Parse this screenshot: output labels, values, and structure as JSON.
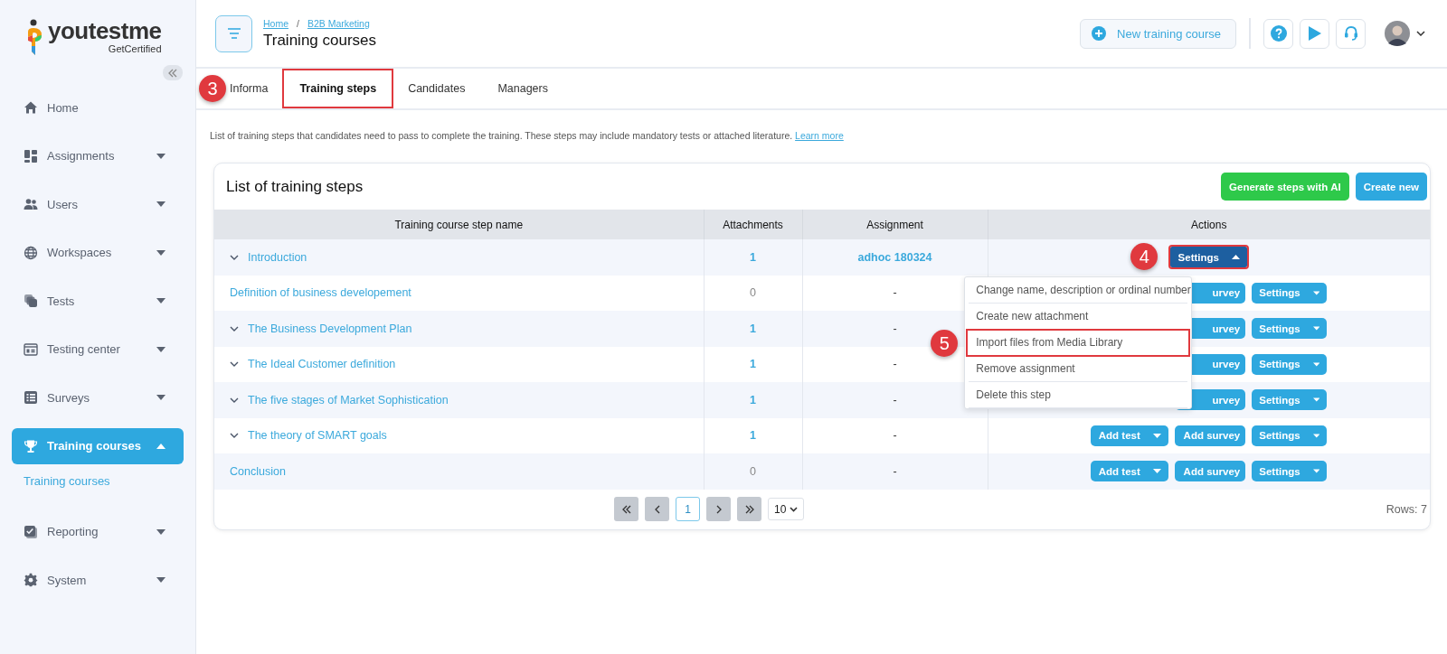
{
  "logo": {
    "name": "youtestme",
    "tagline": "GetCertified"
  },
  "sidebar": {
    "items": [
      {
        "label": "Home",
        "has_children": false,
        "selected": false
      },
      {
        "label": "Assignments",
        "has_children": true,
        "expanded": false,
        "selected": false
      },
      {
        "label": "Users",
        "has_children": true,
        "expanded": false,
        "selected": false
      },
      {
        "label": "Workspaces",
        "has_children": true,
        "expanded": false,
        "selected": false
      },
      {
        "label": "Tests",
        "has_children": true,
        "expanded": false,
        "selected": false
      },
      {
        "label": "Testing center",
        "has_children": true,
        "expanded": false,
        "selected": false
      },
      {
        "label": "Surveys",
        "has_children": true,
        "expanded": false,
        "selected": false
      },
      {
        "label": "Training courses",
        "has_children": true,
        "expanded": true,
        "selected": true,
        "children": [
          {
            "label": "Training courses",
            "selected": true
          }
        ]
      },
      {
        "label": "Reporting",
        "has_children": true,
        "expanded": false,
        "selected": false
      },
      {
        "label": "System",
        "has_children": true,
        "expanded": false,
        "selected": false
      }
    ]
  },
  "breadcrumb": [
    "Home",
    "B2B Marketing"
  ],
  "breadcrumb_separator": "/",
  "page_title": "Training courses",
  "new_button": "New training course",
  "tabs": [
    {
      "label": "Informa",
      "selected": false,
      "highlighted": false
    },
    {
      "label": "Training steps",
      "selected": true,
      "highlighted": true
    },
    {
      "label": "Candidates",
      "selected": false,
      "highlighted": false
    },
    {
      "label": "Managers",
      "selected": false,
      "highlighted": false
    }
  ],
  "description": {
    "text": "List of training steps that candidates need to pass to complete the training. These steps may include mandatory tests or attached literature.",
    "link": "Learn more"
  },
  "card": {
    "title": "List of training steps",
    "buttons": [
      {
        "label": "Generate steps with AI",
        "kind": "ai"
      },
      {
        "label": "Create new",
        "kind": "primary"
      }
    ]
  },
  "table": {
    "columns": [
      "Training course step name",
      "Attachments",
      "Assignment",
      "Actions"
    ],
    "rows": [
      {
        "name": "Introduction",
        "expandable": true,
        "attachments": "1",
        "attachments_linked": true,
        "assignment": "adhoc 180324",
        "assignment_linked": true,
        "actions": [
          {
            "kind": "settings",
            "label": "Settings",
            "open": true,
            "highlighted": true
          }
        ]
      },
      {
        "name": "Definition of business developement",
        "expandable": false,
        "attachments": "0",
        "attachments_linked": false,
        "assignment": "-",
        "assignment_linked": false,
        "actions": [
          {
            "kind": "survey",
            "label": "urvey",
            "open": false,
            "highlighted": false
          },
          {
            "kind": "settings",
            "label": "Settings",
            "open": false,
            "highlighted": false
          }
        ]
      },
      {
        "name": "The Business Development Plan",
        "expandable": true,
        "attachments": "1",
        "attachments_linked": true,
        "assignment": "-",
        "assignment_linked": false,
        "actions": [
          {
            "kind": "survey",
            "label": "urvey",
            "open": false,
            "highlighted": false
          },
          {
            "kind": "settings",
            "label": "Settings",
            "open": false,
            "highlighted": false
          }
        ]
      },
      {
        "name": "The Ideal Customer definition",
        "expandable": true,
        "attachments": "1",
        "attachments_linked": true,
        "assignment": "-",
        "assignment_linked": false,
        "actions": [
          {
            "kind": "survey",
            "label": "urvey",
            "open": false,
            "highlighted": false
          },
          {
            "kind": "settings",
            "label": "Settings",
            "open": false,
            "highlighted": false
          }
        ]
      },
      {
        "name": "The five stages of Market Sophistication",
        "expandable": true,
        "attachments": "1",
        "attachments_linked": true,
        "assignment": "-",
        "assignment_linked": false,
        "actions": [
          {
            "kind": "survey",
            "label": "urvey",
            "open": false,
            "highlighted": false
          },
          {
            "kind": "settings",
            "label": "Settings",
            "open": false,
            "highlighted": false
          }
        ]
      },
      {
        "name": "The theory of SMART goals",
        "expandable": true,
        "attachments": "1",
        "attachments_linked": true,
        "assignment": "-",
        "assignment_linked": false,
        "actions": [
          {
            "kind": "test",
            "label": "Add test",
            "open": false,
            "highlighted": false
          },
          {
            "kind": "survey",
            "label": "Add survey",
            "open": false,
            "highlighted": false
          },
          {
            "kind": "settings",
            "label": "Settings",
            "open": false,
            "highlighted": false
          }
        ]
      },
      {
        "name": "Conclusion",
        "expandable": false,
        "attachments": "0",
        "attachments_linked": false,
        "assignment": "-",
        "assignment_linked": false,
        "actions": [
          {
            "kind": "test",
            "label": "Add test",
            "open": false,
            "highlighted": false
          },
          {
            "kind": "survey",
            "label": "Add survey",
            "open": false,
            "highlighted": false
          },
          {
            "kind": "settings",
            "label": "Settings",
            "open": false,
            "highlighted": false
          }
        ]
      }
    ]
  },
  "settings_menu": [
    {
      "label": "Change name, description or ordinal number",
      "highlighted": false
    },
    {
      "label": "Create new attachment",
      "highlighted": false
    },
    {
      "label": "Import files from Media Library",
      "highlighted": true
    },
    {
      "label": "Remove assignment",
      "highlighted": false
    },
    {
      "label": "Delete this step",
      "highlighted": false
    }
  ],
  "pagination": {
    "pages": [
      {
        "label": "1",
        "selected": true
      }
    ],
    "page_size": "10",
    "rows": "Rows: 7"
  },
  "annotations": [
    "3",
    "4",
    "5"
  ]
}
